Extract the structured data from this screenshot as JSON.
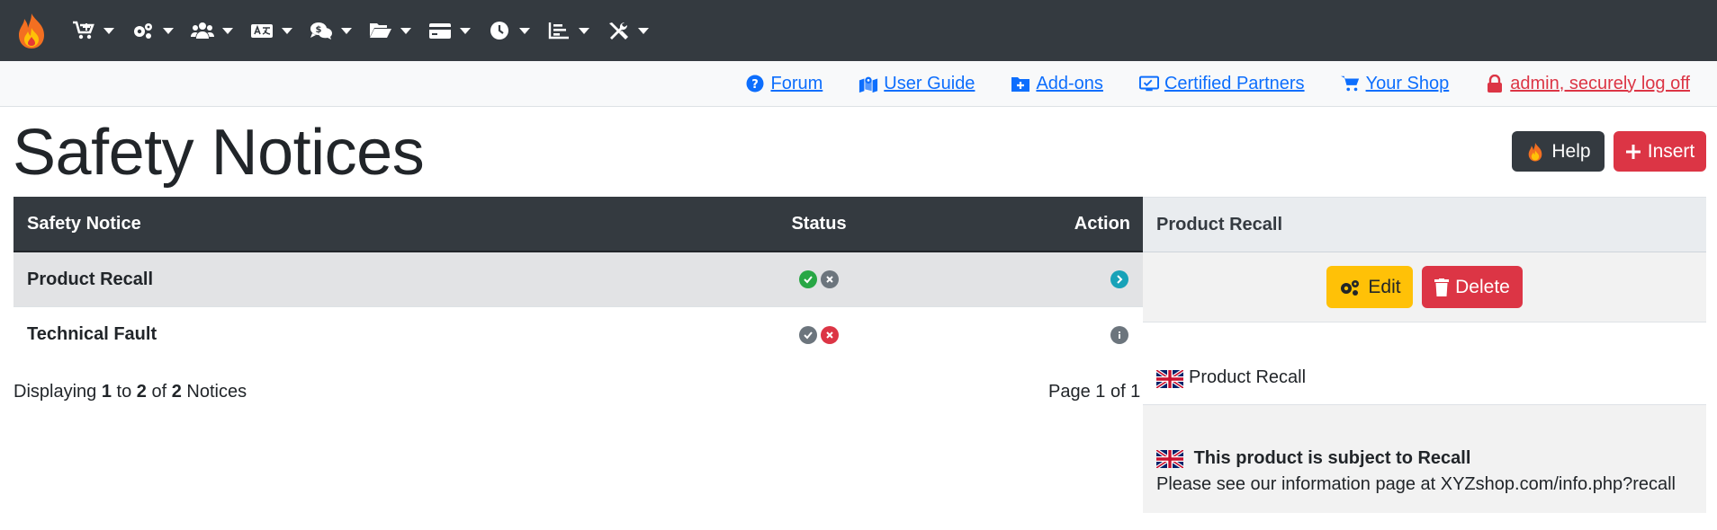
{
  "nav": {
    "items": [
      {
        "icon": "cart-icon"
      },
      {
        "icon": "gears-icon"
      },
      {
        "icon": "users-icon"
      },
      {
        "icon": "language-icon"
      },
      {
        "icon": "comments-dollar-icon"
      },
      {
        "icon": "folder-open-icon"
      },
      {
        "icon": "credit-card-icon"
      },
      {
        "icon": "clock-icon"
      },
      {
        "icon": "chart-bar-icon"
      },
      {
        "icon": "tools-icon"
      }
    ]
  },
  "links": {
    "forum": "Forum",
    "user_guide": "User Guide",
    "addons": "Add-ons",
    "partners": "Certified Partners",
    "shop": "Your Shop",
    "logoff": "admin, securely log off"
  },
  "page": {
    "title": "Safety Notices",
    "help_label": "Help",
    "insert_label": "Insert"
  },
  "table": {
    "headers": {
      "notice": "Safety Notice",
      "status": "Status",
      "action": "Action"
    },
    "rows": [
      {
        "name": "Product Recall",
        "status": "active"
      },
      {
        "name": "Technical Fault",
        "status": "inactive"
      }
    ]
  },
  "footer": {
    "displaying": "Displaying",
    "from": "1",
    "to_word": "to",
    "to": "2",
    "of_word": "of",
    "total": "2",
    "unit": "Notices",
    "page": "Page 1 of 1"
  },
  "panel": {
    "heading": "Product Recall",
    "edit_label": "Edit",
    "delete_label": "Delete",
    "title": "Product Recall",
    "notice_heading": "This product is subject to Recall",
    "notice_text": "Please see our information page at XYZshop.com/info.php?recall"
  },
  "colors": {
    "dark": "#343a40",
    "danger": "#dc3545",
    "warning": "#ffc107",
    "success": "#28a745",
    "info": "#17a2b8",
    "secondary": "#6c757d",
    "link": "#0d6efd"
  }
}
